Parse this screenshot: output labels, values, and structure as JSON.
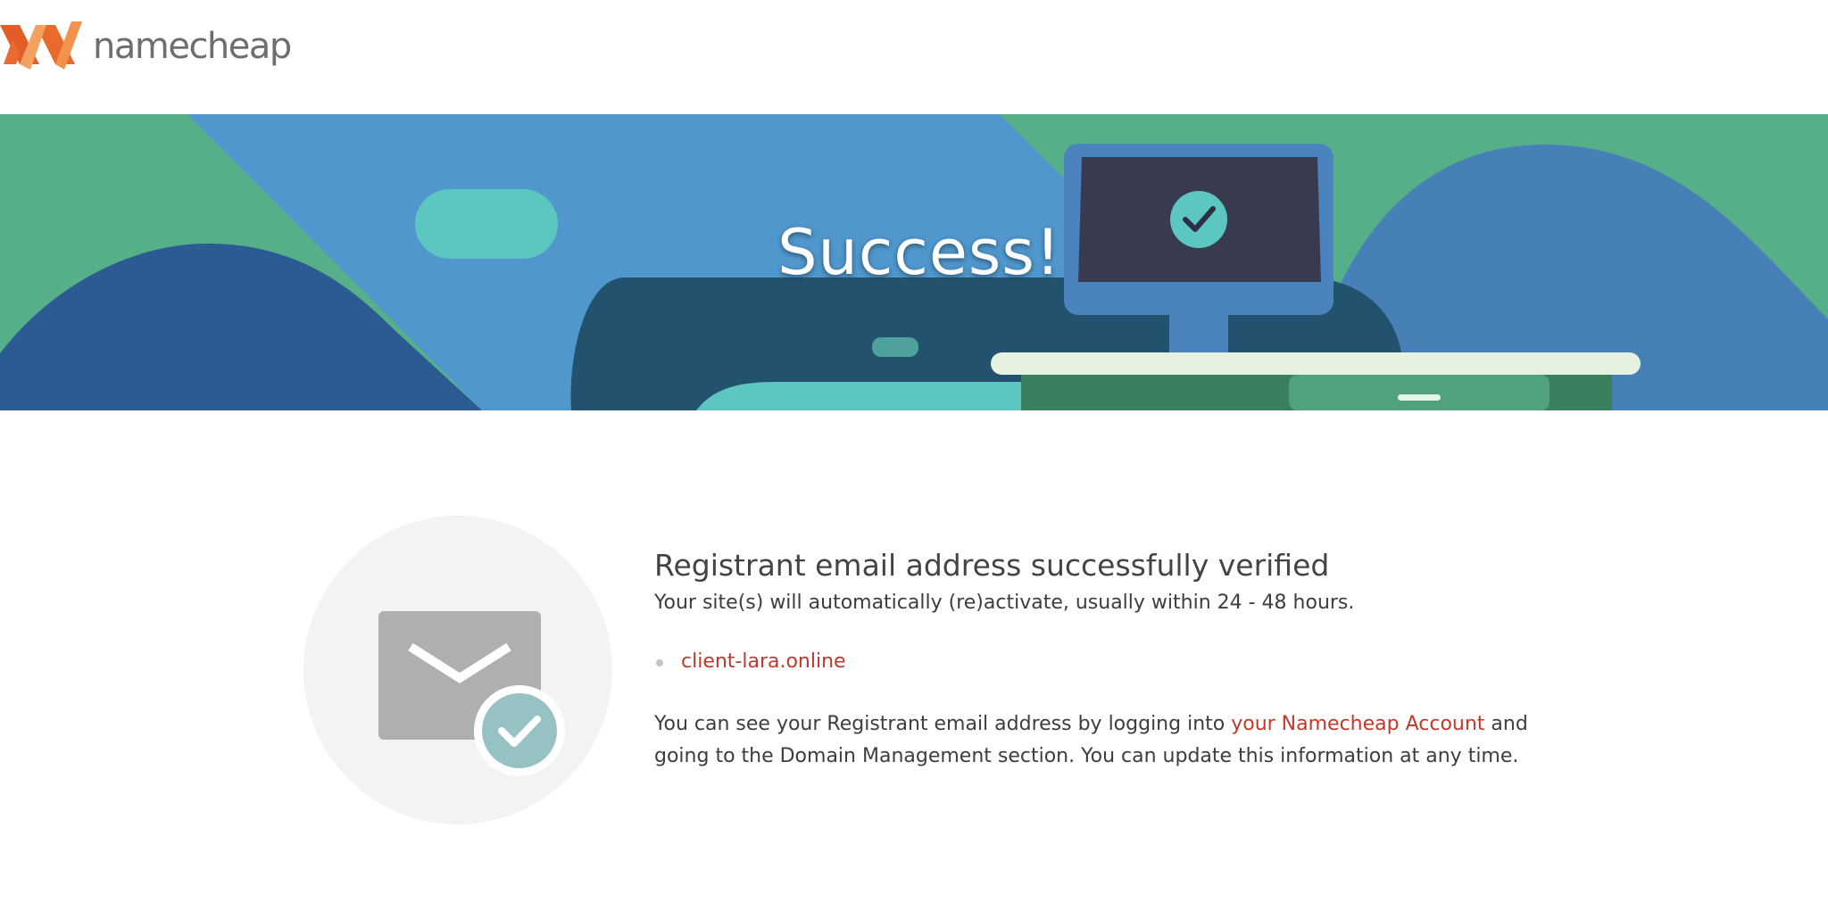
{
  "header": {
    "logo_text": "namecheap",
    "logo_icon": "namecheap-n-icon",
    "brand_colors": [
      "#e96b2f",
      "#f2924b"
    ]
  },
  "hero": {
    "title": "Success!",
    "illustration": "desk-monitor-checkmark-illustration",
    "colors": {
      "green": "#55b08a",
      "blue": "#4f97cd",
      "dark_blue": "#2c5b94",
      "navy_bar": "#22526e",
      "teal": "#5cc6c0",
      "monitor_frame": "#4a83bd",
      "monitor_screen": "#383a50"
    }
  },
  "badge": {
    "icon": "email-verified-icon",
    "check_icon": "checkmark-icon"
  },
  "message": {
    "heading": "Registrant email address successfully verified",
    "subline": "Your site(s) will automatically (re)activate, usually within 24 - 48 hours.",
    "domains": [
      "client-lara.online"
    ],
    "para_before": "You can see your Registrant email address by logging into ",
    "para_link": "your Namecheap Account",
    "para_after": " and going to the Domain Management section. You can update this information at any time.",
    "link_color": "#c0392b"
  }
}
